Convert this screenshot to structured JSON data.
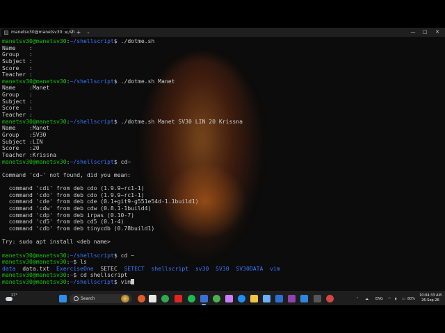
{
  "window": {
    "tab_title": "manetsv30@manetsv30: ~/sh",
    "tab_close": "×",
    "new_tab": "+",
    "tab_dropdown": "⌄",
    "minimize": "—",
    "maximize": "□",
    "close": "✕"
  },
  "terminal": {
    "user_host": "manetsv30@manetsv30",
    "lines": [
      {
        "type": "prompt",
        "path": "~/shellscript",
        "cmd": " ./dotme.sh"
      },
      {
        "type": "out",
        "text": "Name    :"
      },
      {
        "type": "out",
        "text": "Group   :"
      },
      {
        "type": "out",
        "text": "Subject :"
      },
      {
        "type": "out",
        "text": "Score   :"
      },
      {
        "type": "out",
        "text": "Teacher :"
      },
      {
        "type": "prompt",
        "path": "~/shellscript",
        "cmd": " ./dotme.sh Manet"
      },
      {
        "type": "out",
        "text": "Name    :Manet"
      },
      {
        "type": "out",
        "text": "Group   :"
      },
      {
        "type": "out",
        "text": "Subject :"
      },
      {
        "type": "out",
        "text": "Score   :"
      },
      {
        "type": "out",
        "text": "Teacher :"
      },
      {
        "type": "prompt",
        "path": "~/shellscript",
        "cmd": " ./dotme.sh Manet SV30 LIN 20 Krissna"
      },
      {
        "type": "out",
        "text": "Name    :Manet"
      },
      {
        "type": "out",
        "text": "Group   :SV30"
      },
      {
        "type": "out",
        "text": "Subject :LIN"
      },
      {
        "type": "out",
        "text": "Score   :20"
      },
      {
        "type": "out",
        "text": "Teacher :Krissna"
      },
      {
        "type": "prompt",
        "path": "~/shellscript",
        "cmd": " cd~"
      },
      {
        "type": "out",
        "text": ""
      },
      {
        "type": "out",
        "text": "Command 'cd~' not found, did you mean:"
      },
      {
        "type": "out",
        "text": ""
      },
      {
        "type": "out",
        "text": "  command 'cdi' from deb cdo (1.9.9~rc1-1)"
      },
      {
        "type": "out",
        "text": "  command 'cdo' from deb cdo (1.9.9~rc1-1)"
      },
      {
        "type": "out",
        "text": "  command 'cde' from deb cde (0.1+git9-g551e54d-1.1build1)"
      },
      {
        "type": "out",
        "text": "  command 'cdw' from deb cdw (0.8.1-1build4)"
      },
      {
        "type": "out",
        "text": "  command 'cdp' from deb irpas (0.10-7)"
      },
      {
        "type": "out",
        "text": "  command 'cd5' from deb cd5 (0.1-4)"
      },
      {
        "type": "out",
        "text": "  command 'cdb' from deb tinycdb (0.78build1)"
      },
      {
        "type": "out",
        "text": ""
      },
      {
        "type": "out",
        "text": "Try: sudo apt install <deb name>"
      },
      {
        "type": "out",
        "text": ""
      },
      {
        "type": "prompt",
        "path": "~/shellscript",
        "cmd": " cd ~"
      },
      {
        "type": "prompt",
        "path": "~",
        "cmd": " ls"
      },
      {
        "type": "ls",
        "items": [
          {
            "name": "data",
            "kind": "dir"
          },
          {
            "name": "data.txt",
            "kind": "file"
          },
          {
            "name": "ExerciseOne",
            "kind": "dir"
          },
          {
            "name": "SETEC",
            "kind": "file"
          },
          {
            "name": "SETECT",
            "kind": "dir"
          },
          {
            "name": "shellscript",
            "kind": "dir"
          },
          {
            "name": "sv30",
            "kind": "dir"
          },
          {
            "name": "SV30",
            "kind": "dir"
          },
          {
            "name": "SV30DATA",
            "kind": "dir"
          },
          {
            "name": "vim",
            "kind": "dir"
          }
        ]
      },
      {
        "type": "prompt",
        "path": "~",
        "cmd": " cd shellscript"
      },
      {
        "type": "prompt",
        "path": "~/shellscript",
        "cmd": " vim",
        "cursor": true
      }
    ]
  },
  "taskbar": {
    "temperature": "27°",
    "search_label": "Search",
    "language": "ENG",
    "battery": "80%",
    "time": "10:04:33 AM",
    "date": "26-Sep-26"
  },
  "colors": {
    "user_host": "#16c60c",
    "path": "#3b78ff",
    "text": "#cccccc",
    "background": "#0c0c0c"
  }
}
